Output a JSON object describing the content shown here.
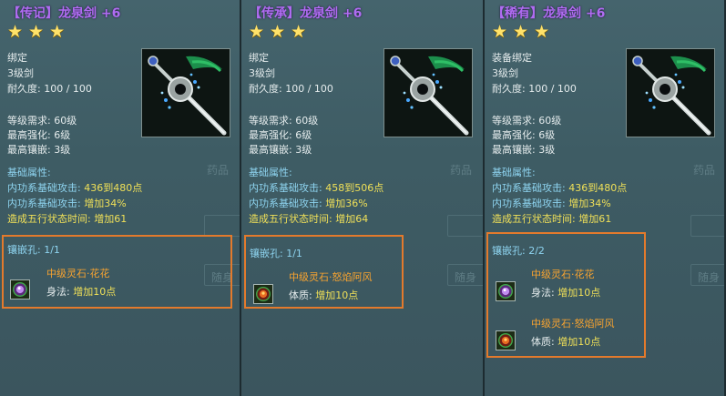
{
  "panels": [
    {
      "title": "【传记】龙泉剑 +6",
      "stars": 3,
      "lines": [
        "绑定",
        "3级剑",
        "耐久度: 100 / 100"
      ],
      "req": [
        "等级需求: 60级",
        "最高强化: 6级",
        "最高镶嵌: 3级"
      ],
      "base_header": "基础属性:",
      "base": [
        {
          "label": "内功系基础攻击: ",
          "value": "436到480点"
        },
        {
          "label": "内功系基础攻击: ",
          "value": "增加34%"
        },
        {
          "label": "造成五行状态时间: ",
          "value": "增加61"
        }
      ],
      "socket_header": "镶嵌孔: 1/1",
      "gems": [
        {
          "name": "中级灵石·花花",
          "stat": "身法:",
          "bonus": "增加10点",
          "icon": "purple-gem-icon"
        }
      ]
    },
    {
      "title": "【传承】龙泉剑 +6",
      "stars": 3,
      "lines": [
        "绑定",
        "3级剑",
        "耐久度: 100 / 100"
      ],
      "req": [
        "等级需求: 60级",
        "最高强化: 6级",
        "最高镶嵌: 3级"
      ],
      "base_header": "基础属性:",
      "base": [
        {
          "label": "内功系基础攻击: ",
          "value": "458到506点"
        },
        {
          "label": "内功系基础攻击: ",
          "value": "增加36%"
        },
        {
          "label": "造成五行状态时间: ",
          "value": "增加64"
        }
      ],
      "socket_header": "镶嵌孔: 1/1",
      "gems": [
        {
          "name": "中级灵石·怒焰阿风",
          "stat": "体质:",
          "bonus": "增加10点",
          "icon": "red-gem-icon"
        }
      ]
    },
    {
      "title": "【稀有】龙泉剑 +6",
      "stars": 3,
      "lines": [
        "装备绑定",
        "3级剑",
        "耐久度: 100 / 100"
      ],
      "req": [
        "等级需求: 60级",
        "最高强化: 6级",
        "最高镶嵌: 3级"
      ],
      "base_header": "基础属性:",
      "base": [
        {
          "label": "内功系基础攻击: ",
          "value": "436到480点"
        },
        {
          "label": "内功系基础攻击: ",
          "value": "增加34%"
        },
        {
          "label": "造成五行状态时间: ",
          "value": "增加61"
        }
      ],
      "socket_header": "镶嵌孔: 2/2",
      "gems": [
        {
          "name": "中级灵石·花花",
          "stat": "身法:",
          "bonus": "增加10点",
          "icon": "purple-gem-icon"
        },
        {
          "name": "中级灵石·怒焰阿风",
          "stat": "体质:",
          "bonus": "增加10点",
          "icon": "red-gem-icon"
        }
      ]
    }
  ],
  "background_ui": {
    "tab_label_1": "药品",
    "tab_label_2": "随身"
  },
  "colors": {
    "title": "#b06cf2",
    "star": "#ffe26a",
    "section": "#8ed4f0",
    "value": "#f0e058",
    "gem_name": "#f7a330",
    "socket_border": "#e37a2c"
  }
}
